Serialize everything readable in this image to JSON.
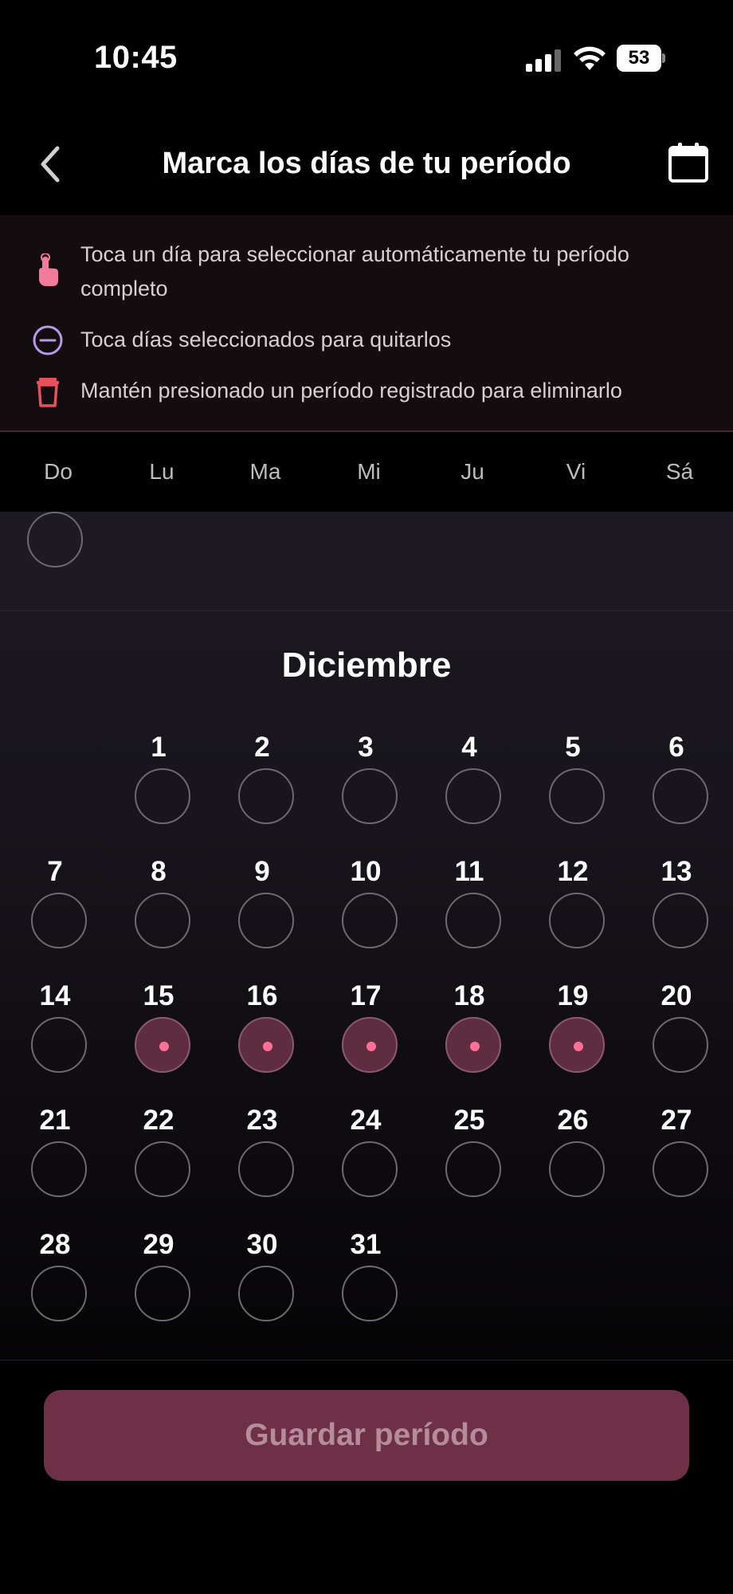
{
  "status_bar": {
    "time": "10:45",
    "battery": "53"
  },
  "header": {
    "title": "Marca los días de tu período"
  },
  "instructions": [
    {
      "icon": "tap-hand-icon",
      "text": "Toca un día para seleccionar automáticamente tu período completo"
    },
    {
      "icon": "minus-circle-icon",
      "text": "Toca días seleccionados para quitarlos"
    },
    {
      "icon": "trash-icon",
      "text": "Mantén presionado un período registrado para eliminarlo"
    }
  ],
  "weekdays": [
    "Do",
    "Lu",
    "Ma",
    "Mi",
    "Ju",
    "Vi",
    "Sá"
  ],
  "calendar": {
    "month": "Diciembre",
    "first_weekday_index": 1,
    "days_in_month": 31,
    "selected_days": [
      15,
      16,
      17,
      18,
      19
    ]
  },
  "footer": {
    "save_label": "Guardar período"
  },
  "colors": {
    "accent": "#6e3047",
    "selected_fill": "#5e2d3f",
    "dot": "#ff6f97",
    "info_panel_bg": "#140d10"
  }
}
